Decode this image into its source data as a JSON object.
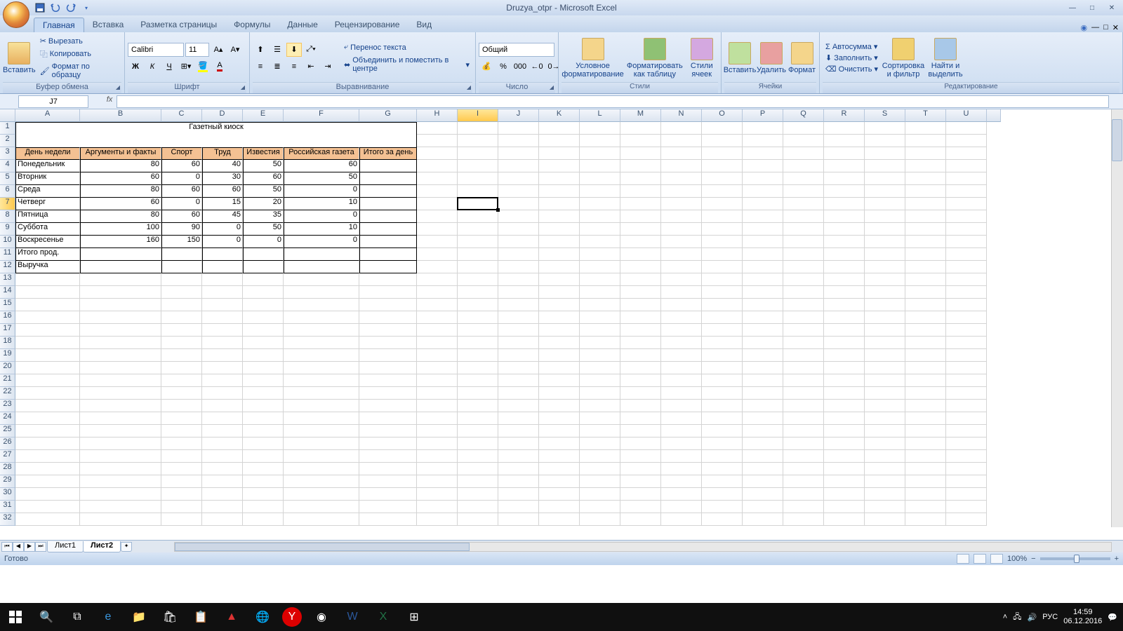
{
  "title": "Druzya_otpr - Microsoft Excel",
  "tabs": [
    "Главная",
    "Вставка",
    "Разметка страницы",
    "Формулы",
    "Данные",
    "Рецензирование",
    "Вид"
  ],
  "active_tab": 0,
  "ribbon": {
    "clipboard": {
      "paste": "Вставить",
      "cut": "Вырезать",
      "copy": "Копировать",
      "format": "Формат по образцу",
      "label": "Буфер обмена"
    },
    "font": {
      "name": "Calibri",
      "size": "11",
      "label": "Шрифт"
    },
    "align": {
      "wrap": "Перенос текста",
      "merge": "Объединить и поместить в центре",
      "label": "Выравнивание"
    },
    "number": {
      "format": "Общий",
      "label": "Число"
    },
    "styles": {
      "cond": "Условное форматирование",
      "table": "Форматировать как таблицу",
      "cell": "Стили ячеек",
      "label": "Стили"
    },
    "cells": {
      "insert": "Вставить",
      "delete": "Удалить",
      "format": "Формат",
      "label": "Ячейки"
    },
    "editing": {
      "sum": "Автосумма",
      "fill": "Заполнить",
      "clear": "Очистить",
      "sort": "Сортировка и фильтр",
      "find": "Найти и выделить",
      "label": "Редактирование"
    }
  },
  "namebox": "J7",
  "formula": "",
  "columns": [
    "A",
    "B",
    "C",
    "D",
    "E",
    "F",
    "G",
    "H",
    "I",
    "J",
    "K",
    "L",
    "M",
    "N",
    "O",
    "P",
    "Q",
    "R",
    "S",
    "T",
    "U"
  ],
  "sheet": {
    "title": "Газетный киоск",
    "headers": [
      "День недели",
      "Аргументы и факты",
      "Спорт",
      "Труд",
      "Известия",
      "Российская газета",
      "Итого за день"
    ],
    "rows": [
      {
        "day": "Понедельник",
        "v": [
          "80",
          "60",
          "40",
          "50",
          "60",
          ""
        ]
      },
      {
        "day": "Вторник",
        "v": [
          "60",
          "0",
          "30",
          "60",
          "50",
          ""
        ]
      },
      {
        "day": "Среда",
        "v": [
          "80",
          "60",
          "60",
          "50",
          "0",
          ""
        ]
      },
      {
        "day": "Четверг",
        "v": [
          "60",
          "0",
          "15",
          "20",
          "10",
          ""
        ]
      },
      {
        "day": "Пятница",
        "v": [
          "80",
          "60",
          "45",
          "35",
          "0",
          ""
        ]
      },
      {
        "day": "Суббота",
        "v": [
          "100",
          "90",
          "0",
          "50",
          "10",
          ""
        ]
      },
      {
        "day": "Воскресенье",
        "v": [
          "160",
          "150",
          "0",
          "0",
          "0",
          ""
        ]
      }
    ],
    "footers": [
      "Итого прод.",
      "Выручка"
    ]
  },
  "selected_cell": "J7",
  "selected_col_idx": 9,
  "selected_row_idx": 7,
  "sheet_tabs": [
    "Лист1",
    "Лист2"
  ],
  "active_sheet": 1,
  "status": "Готово",
  "zoom": "100%",
  "lang": "РУС",
  "time": "14:59",
  "date": "06.12.2016"
}
